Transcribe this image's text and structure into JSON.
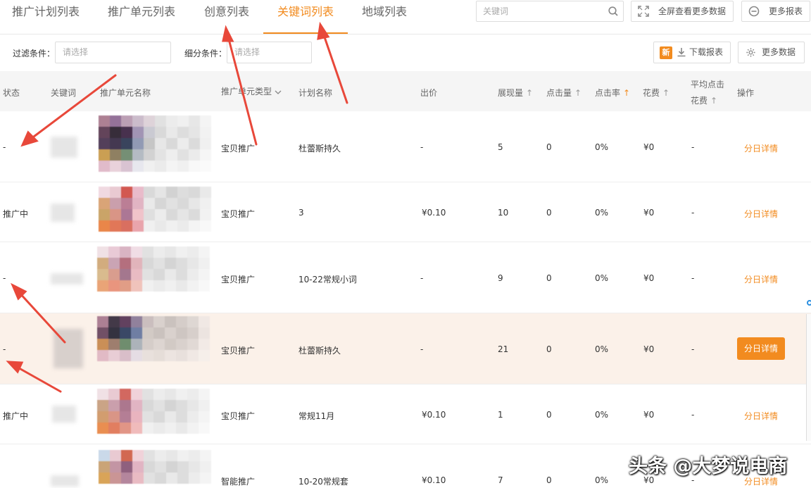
{
  "tabs": [
    {
      "label": "推广计划列表",
      "active": false
    },
    {
      "label": "推广单元列表",
      "active": false
    },
    {
      "label": "创意列表",
      "active": false
    },
    {
      "label": "关键词列表",
      "active": true
    },
    {
      "label": "地域列表",
      "active": false
    }
  ],
  "search": {
    "placeholder": "关键词",
    "icon": "search-icon"
  },
  "toolbar": {
    "fullscreen_label": "全屏查看更多数据",
    "more_reports_label": "更多报表",
    "new_badge": "新",
    "download_label": "下载报表",
    "more_data_label": "更多数据"
  },
  "filters": {
    "filter_label": "过滤条件：",
    "filter_placeholder": "请选择",
    "segment_label": "细分条件：",
    "segment_placeholder": "请选择"
  },
  "table": {
    "headers": {
      "status": "状态",
      "keyword": "关键词",
      "unit_name": "推广单元名称",
      "unit_type": "推广单元类型",
      "plan_name": "计划名称",
      "bid": "出价",
      "impressions": "展现量",
      "clicks": "点击量",
      "ctr": "点击率",
      "cost": "花费",
      "avg_cpc_line1": "平均点击",
      "avg_cpc_line2": "花费",
      "action": "操作"
    },
    "rows": [
      {
        "status": "-",
        "unit_type": "宝贝推广",
        "plan_name": "杜蕾斯持久",
        "bid": "-",
        "impressions": "5",
        "clicks": "0",
        "ctr": "0%",
        "cost": "¥0",
        "avg_cpc": "-",
        "action": "分日详情"
      },
      {
        "status": "推广中",
        "unit_type": "宝贝推广",
        "plan_name": "3",
        "bid": "¥0.10",
        "impressions": "10",
        "clicks": "0",
        "ctr": "0%",
        "cost": "¥0",
        "avg_cpc": "-",
        "action": "分日详情"
      },
      {
        "status": "-",
        "unit_type": "宝贝推广",
        "plan_name": "10-22常规小词",
        "bid": "-",
        "impressions": "9",
        "clicks": "0",
        "ctr": "0%",
        "cost": "¥0",
        "avg_cpc": "-",
        "action": "分日详情"
      },
      {
        "status": "-",
        "unit_type": "宝贝推广",
        "plan_name": "杜蕾斯持久",
        "bid": "-",
        "impressions": "21",
        "clicks": "0",
        "ctr": "0%",
        "cost": "¥0",
        "avg_cpc": "-",
        "action": "分日详情"
      },
      {
        "status": "推广中",
        "unit_type": "宝贝推广",
        "plan_name": "常规11月",
        "bid": "¥0.10",
        "impressions": "1",
        "clicks": "0",
        "ctr": "0%",
        "cost": "¥0",
        "avg_cpc": "-",
        "action": "分日详情"
      },
      {
        "status": "",
        "unit_type": "智能推广",
        "plan_name": "10-20常规套",
        "bid": "¥0.10",
        "impressions": "7",
        "clicks": "0",
        "ctr": "0%",
        "cost": "¥0",
        "avg_cpc": "-",
        "action": "分日详情"
      }
    ]
  },
  "watermark": "头条 @大梦说电商",
  "colors": {
    "accent": "#f28b1f",
    "highlight_row": "#fbf1e9",
    "arrow": "#e8483a"
  }
}
